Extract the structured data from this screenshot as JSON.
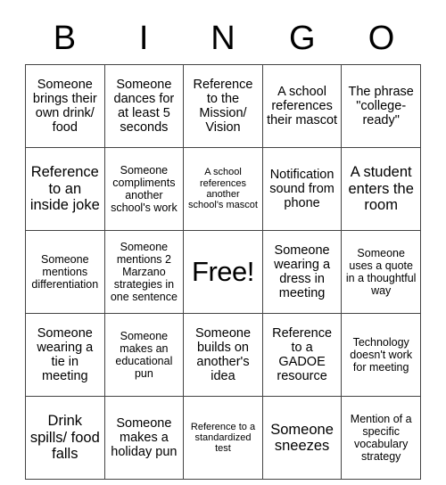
{
  "card": {
    "header_letters": [
      "B",
      "I",
      "N",
      "G",
      "O"
    ],
    "rows": [
      [
        {
          "text": "Someone brings their own drink/ food",
          "size": "sz-m"
        },
        {
          "text": "Someone dances for at least 5 seconds",
          "size": "sz-m"
        },
        {
          "text": "Reference to the Mission/ Vision",
          "size": "sz-m"
        },
        {
          "text": "A school references their mascot",
          "size": "sz-m"
        },
        {
          "text": "The phrase \"college-ready\"",
          "size": "sz-m"
        }
      ],
      [
        {
          "text": "Reference to an inside joke",
          "size": "sz-l"
        },
        {
          "text": "Someone compliments another school's work",
          "size": "sz-s"
        },
        {
          "text": "A school references another school's mascot",
          "size": "sz-xs"
        },
        {
          "text": "Notification sound from phone",
          "size": "sz-m"
        },
        {
          "text": "A student enters the room",
          "size": "sz-l"
        }
      ],
      [
        {
          "text": "Someone mentions differentiation",
          "size": "sz-s"
        },
        {
          "text": "Someone mentions 2 Marzano strategies in one sentence",
          "size": "sz-s"
        },
        {
          "text": "Free!",
          "size": "sz-free"
        },
        {
          "text": "Someone wearing a dress in meeting",
          "size": "sz-m"
        },
        {
          "text": "Someone uses a quote in a thoughtful way",
          "size": "sz-s"
        }
      ],
      [
        {
          "text": "Someone wearing a tie in meeting",
          "size": "sz-m"
        },
        {
          "text": "Someone makes an educational pun",
          "size": "sz-s"
        },
        {
          "text": "Someone builds on another's idea",
          "size": "sz-m"
        },
        {
          "text": "Reference to a GADOE resource",
          "size": "sz-m"
        },
        {
          "text": "Technology doesn't work for meeting",
          "size": "sz-s"
        }
      ],
      [
        {
          "text": "Drink spills/ food falls",
          "size": "sz-l"
        },
        {
          "text": "Someone makes a holiday pun",
          "size": "sz-m"
        },
        {
          "text": "Reference to a standardized test",
          "size": "sz-xs"
        },
        {
          "text": "Someone sneezes",
          "size": "sz-l"
        },
        {
          "text": "Mention of a specific vocabulary strategy",
          "size": "sz-s"
        }
      ]
    ]
  },
  "colors": {
    "background": "#ffffff",
    "text": "#000000",
    "grid_line": "#444444"
  }
}
